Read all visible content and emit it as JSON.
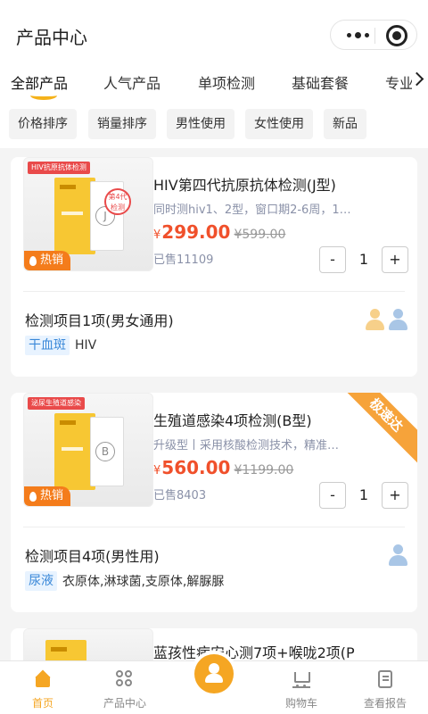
{
  "nav": {
    "title": "产品中心"
  },
  "tabs": [
    "全部产品",
    "人气产品",
    "单项检测",
    "基础套餐",
    "专业"
  ],
  "filters": [
    "价格排序",
    "销量排序",
    "男性使用",
    "女性使用",
    "新品"
  ],
  "products": [
    {
      "thumb_banner": "HIV抗原抗体检测",
      "thumb_seal": "第4代检测",
      "thumb_letter": "J",
      "hot_label": "热销",
      "name": "HIV第四代抗原抗体检测(J型)",
      "desc": "同时测hiv1、2型，窗口期2-6周，1…",
      "currency": "¥",
      "price": "299.00",
      "old_price": "¥599.00",
      "sold": "已售11109",
      "qty": "1",
      "minus": "-",
      "plus": "+",
      "items_title": "检测项目1项(男女通用)",
      "sample": "干血斑",
      "items": "HIV",
      "gender": [
        "female",
        "male"
      ]
    },
    {
      "thumb_banner": "泌尿生殖道感染",
      "thumb_letter": "B",
      "hot_label": "热销",
      "ribbon": "极速达",
      "name": "生殖道感染4项检测(B型)",
      "desc": "升级型丨采用核酸检测技术，精准…",
      "currency": "¥",
      "price": "560.00",
      "old_price": "¥1199.00",
      "sold": "已售8403",
      "qty": "1",
      "minus": "-",
      "plus": "+",
      "items_title": "检测项目4项(男性用)",
      "sample": "尿液",
      "items": "衣原体,淋球菌,支原体,解脲脲",
      "gender": [
        "male"
      ]
    },
    {
      "name": "蓝孩性病安心测7项+喉咙2项(P"
    }
  ],
  "tabbar": {
    "home": "首页",
    "products": "产品中心",
    "cart": "购物车",
    "report": "查看报告"
  },
  "colors": {
    "accent": "#f5a623",
    "price": "#f0502b",
    "hot": "#f47c1b",
    "tag_bg": "#e8f3ff",
    "tag_text": "#3a88d8"
  }
}
